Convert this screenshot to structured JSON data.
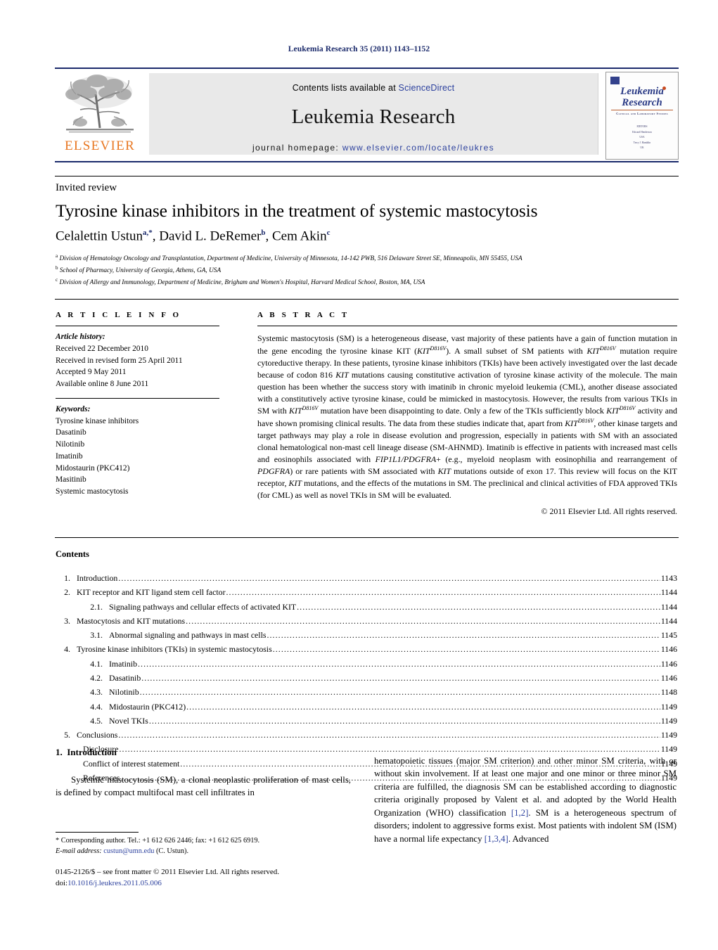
{
  "running_head": "Leukemia Research 35 (2011) 1143–1152",
  "masthead": {
    "publisher_name": "ELSEVIER",
    "contents_text": "Contents lists available at ",
    "sciencedirect": "ScienceDirect",
    "journal_title": "Leukemia Research",
    "homepage_label": "journal homepage:",
    "homepage_url": "www.elsevier.com/locate/leukres",
    "cover": {
      "line1": "Leukemia",
      "line2": "Research",
      "subtitle": "Clinical and Laboratory Studies",
      "meta1": "EDITORS",
      "meta2": "Edward Henderson",
      "meta3": "USA",
      "meta4": "Terry J. Hamblin",
      "meta5": "UK"
    }
  },
  "article": {
    "type_label": "Invited review",
    "title": "Tyrosine kinase inhibitors in the treatment of systemic mastocytosis",
    "authors_plain": "Celalettin Ustun, David L. DeRemer, Cem Akin",
    "author_list": [
      {
        "name": "Celalettin Ustun",
        "marks": "a,*"
      },
      {
        "name": "David L. DeRemer",
        "marks": "b"
      },
      {
        "name": "Cem Akin",
        "marks": "c"
      }
    ],
    "affiliations": [
      {
        "mark": "a",
        "text": "Division of Hematology Oncology and Transplantation, Department of Medicine, University of Minnesota, 14-142 PWB, 516 Delaware Street SE, Minneapolis, MN 55455, USA"
      },
      {
        "mark": "b",
        "text": "School of Pharmacy, University of Georgia, Athens, GA, USA"
      },
      {
        "mark": "c",
        "text": "Division of Allergy and Immunology, Department of Medicine, Brigham and Women's Hospital, Harvard Medical School, Boston, MA, USA"
      }
    ]
  },
  "article_info": {
    "heading": "A R T I C L E   I N F O",
    "history_label": "Article history:",
    "history": [
      "Received 22 December 2010",
      "Received in revised form 25 April 2011",
      "Accepted 9 May 2011",
      "Available online 8 June 2011"
    ],
    "keywords_label": "Keywords:",
    "keywords": [
      "Tyrosine kinase inhibitors",
      "Dasatinib",
      "Nilotinib",
      "Imatinib",
      "Midostaurin (PKC412)",
      "Masitinib",
      "Systemic mastocytosis"
    ]
  },
  "abstract": {
    "heading": "A B S T R A C T",
    "text_html": "Systemic mastocytosis (SM) is a heterogeneous disease, vast majority of these patients have a gain of function mutation in the gene encoding the tyrosine kinase KIT (<i>KIT<sup>D816V</sup></i>). A small subset of SM patients with <i>KIT<sup>D816V</sup></i> mutation require cytoreductive therapy. In these patients, tyrosine kinase inhibitors (TKIs) have been actively investigated over the last decade because of codon 816 <i>KIT</i> mutations causing constitutive activation of tyrosine kinase activity of the molecule. The main question has been whether the success story with imatinib in chronic myeloid leukemia (CML), another disease associated with a constitutively active tyrosine kinase, could be mimicked in mastocytosis. However, the results from various TKIs in SM with <i>KIT<sup>D816V</sup></i> mutation have been disappointing to date. Only a few of the TKIs sufficiently block <i>KIT<sup>D816V</sup></i> activity and have shown promising clinical results. The data from these studies indicate that, apart from <i>KIT<sup>D816V</sup></i>, other kinase targets and target pathways may play a role in disease evolution and progression, especially in patients with SM with an associated clonal hematological non-mast cell lineage disease (SM-AHNMD). Imatinib is effective in patients with increased mast cells and eosinophils associated with <i>FIP1L1/PDGFRA</i>+ (e.g., myeloid neoplasm with eosinophilia and rearrangement of <i>PDGFRA</i>) or rare patients with SM associated with <i>KIT</i> mutations outside of exon 17. This review will focus on the KIT receptor, <i>KIT</i> mutations, and the effects of the mutations in SM. The preclinical and clinical activities of FDA approved TKIs (for CML) as well as novel TKIs in SM will be evaluated.",
    "copyright": "© 2011 Elsevier Ltd. All rights reserved."
  },
  "contents": {
    "heading": "Contents",
    "entries": [
      {
        "num": "1.",
        "label": "Introduction",
        "page": "1143",
        "level": 1
      },
      {
        "num": "2.",
        "label": "KIT receptor and KIT ligand stem cell factor",
        "page": "1144",
        "level": 1
      },
      {
        "num": "2.1.",
        "label": "Signaling pathways and cellular effects of activated KIT",
        "page": "1144",
        "level": 2
      },
      {
        "num": "3.",
        "label": "Mastocytosis and KIT mutations",
        "page": "1144",
        "level": 1
      },
      {
        "num": "3.1.",
        "label": "Abnormal signaling and pathways in mast cells",
        "page": "1145",
        "level": 2
      },
      {
        "num": "4.",
        "label": "Tyrosine kinase inhibitors (TKIs) in systemic mastocytosis",
        "page": "1146",
        "level": 1
      },
      {
        "num": "4.1.",
        "label": "Imatinib",
        "page": "1146",
        "level": 2
      },
      {
        "num": "4.2.",
        "label": "Dasatinib",
        "page": "1146",
        "level": 2
      },
      {
        "num": "4.3.",
        "label": "Nilotinib",
        "page": "1148",
        "level": 2
      },
      {
        "num": "4.4.",
        "label": "Midostaurin (PKC412)",
        "page": "1149",
        "level": 2
      },
      {
        "num": "4.5.",
        "label": "Novel TKIs",
        "page": "1149",
        "level": 2
      },
      {
        "num": "5.",
        "label": "Conclusions",
        "page": "1149",
        "level": 1
      },
      {
        "num": "",
        "label": "Disclosure",
        "page": "1149",
        "level": 0
      },
      {
        "num": "",
        "label": "Conflict of interest statement",
        "page": "1149",
        "level": 0
      },
      {
        "num": "",
        "label": "References",
        "page": "1149",
        "level": 0
      }
    ]
  },
  "body": {
    "section_number": "1.",
    "section_title": "Introduction",
    "left_text": "Systemic mastocytosis (SM), a clonal neoplastic proliferation of mast cells, is defined by compact multifocal mast cell infiltrates in",
    "right_text_html": "hematopoietic tissues (major SM criterion) and other minor SM criteria, with or without skin involvement. If at least one major and one minor or three minor SM criteria are fulfilled, the diagnosis SM can be established according to diagnostic criteria originally proposed by Valent et al. and adopted by the World Health Organization (WHO) classification <span class=\"reflink\">[1,2]</span>. SM is a heterogeneous spectrum of disorders; indolent to aggressive forms exist. Most patients with indolent SM (ISM) have a normal life expectancy <span class=\"reflink\">[1,3,4]</span>. Advanced"
  },
  "footer": {
    "corresponding_html": "* Corresponding author. Tel.: +1 612 626 2446; fax: +1 612 625 6919.",
    "email_label": "E-mail address:",
    "email": "custun@umn.edu",
    "email_suffix": "(C. Ustun).",
    "issn_line": "0145-2126/$ – see front matter © 2011 Elsevier Ltd. All rights reserved.",
    "doi_label": "doi:",
    "doi": "10.1016/j.leukres.2011.05.006"
  }
}
